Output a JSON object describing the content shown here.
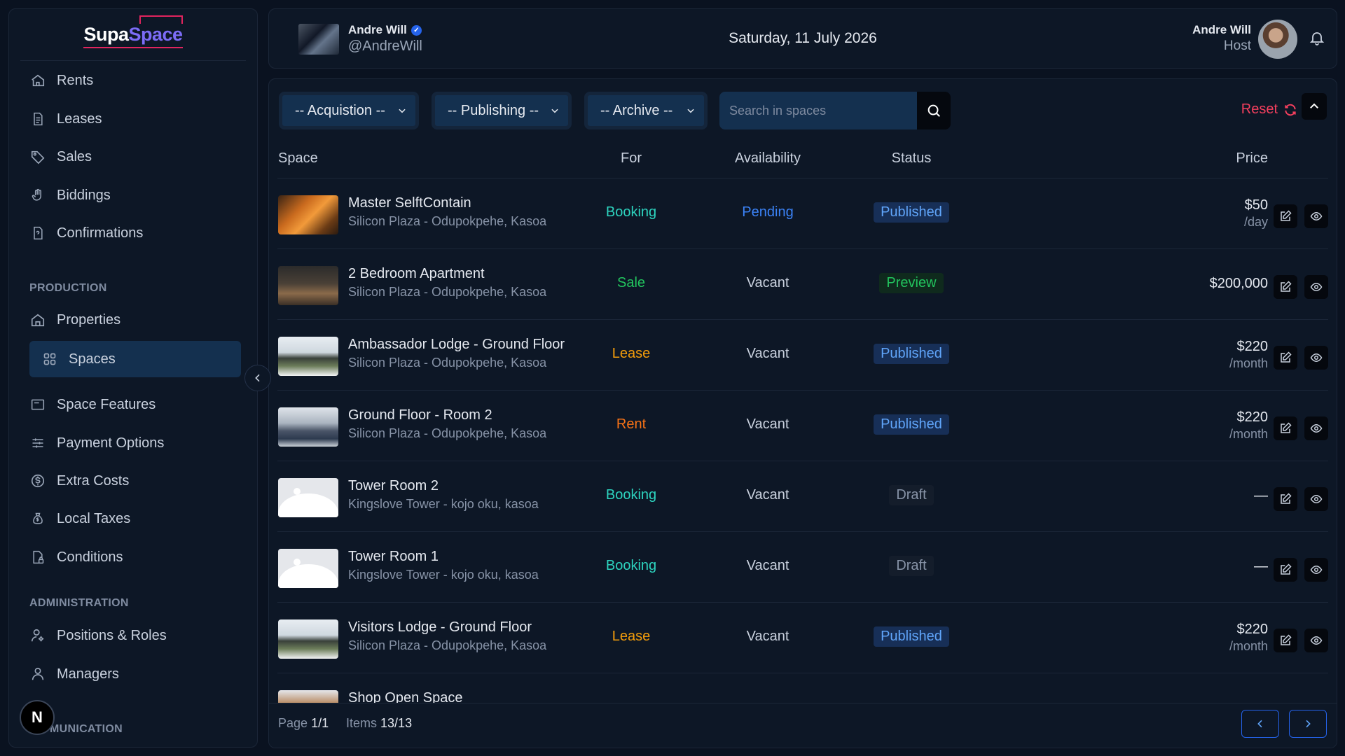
{
  "brand": {
    "part1": "Supa",
    "part2": "Space"
  },
  "sidebar": {
    "main_items": [
      {
        "label": "Rents",
        "icon": "home-icon"
      },
      {
        "label": "Leases",
        "icon": "document-icon"
      },
      {
        "label": "Sales",
        "icon": "tag-icon"
      },
      {
        "label": "Biddings",
        "icon": "hand-icon"
      },
      {
        "label": "Confirmations",
        "icon": "file-check-icon"
      }
    ],
    "production_label": "PRODUCTION",
    "production_items": [
      {
        "label": "Properties",
        "icon": "building-icon"
      },
      {
        "label": "Spaces",
        "icon": "grid-icon",
        "active": true
      },
      {
        "label": "Space Features",
        "icon": "panel-icon"
      },
      {
        "label": "Payment Options",
        "icon": "sliders-icon"
      },
      {
        "label": "Extra Costs",
        "icon": "dollar-icon"
      },
      {
        "label": "Local Taxes",
        "icon": "tax-icon"
      },
      {
        "label": "Conditions",
        "icon": "file-lock-icon"
      }
    ],
    "administration_label": "ADMINISTRATION",
    "administration_items": [
      {
        "label": "Positions & Roles",
        "icon": "user-key-icon"
      },
      {
        "label": "Managers",
        "icon": "user-icon"
      }
    ],
    "communication_label": "MUNICATION",
    "badge_letter": "N"
  },
  "header": {
    "name": "Andre Will",
    "handle": "@AndreWill",
    "date": "Saturday, 11 July 2026",
    "user_name": "Andre Will",
    "user_role": "Host"
  },
  "filters": {
    "acquisition": "-- Acquistion --",
    "publishing": "-- Publishing --",
    "archive": "-- Archive --",
    "search_placeholder": "Search in spaces",
    "reset": "Reset"
  },
  "table": {
    "headers": {
      "space": "Space",
      "for": "For",
      "availability": "Availability",
      "status": "Status",
      "price": "Price"
    },
    "rows": [
      {
        "title": "Master SelftContain",
        "sub": "Silicon Plaza - Odupokpehe, Kasoa",
        "for": "Booking",
        "availability": "Pending",
        "status": "Published",
        "price": "$50",
        "per": "/day"
      },
      {
        "title": "2 Bedroom Apartment",
        "sub": "Silicon Plaza - Odupokpehe, Kasoa",
        "for": "Sale",
        "availability": "Vacant",
        "status": "Preview",
        "price": "$200,000",
        "per": ""
      },
      {
        "title": "Ambassador Lodge - Ground Floor",
        "sub": "Silicon Plaza - Odupokpehe, Kasoa",
        "for": "Lease",
        "availability": "Vacant",
        "status": "Published",
        "price": "$220",
        "per": "/month"
      },
      {
        "title": "Ground Floor - Room 2",
        "sub": "Silicon Plaza - Odupokpehe, Kasoa",
        "for": "Rent",
        "availability": "Vacant",
        "status": "Published",
        "price": "$220",
        "per": "/month"
      },
      {
        "title": "Tower Room 2",
        "sub": "Kingslove Tower - kojo oku, kasoa",
        "for": "Booking",
        "availability": "Vacant",
        "status": "Draft",
        "price": "—",
        "per": ""
      },
      {
        "title": "Tower Room 1",
        "sub": "Kingslove Tower - kojo oku, kasoa",
        "for": "Booking",
        "availability": "Vacant",
        "status": "Draft",
        "price": "—",
        "per": ""
      },
      {
        "title": "Visitors Lodge - Ground Floor",
        "sub": "Silicon Plaza - Odupokpehe, Kasoa",
        "for": "Lease",
        "availability": "Vacant",
        "status": "Published",
        "price": "$220",
        "per": "/month"
      },
      {
        "title": "Shop Open Space",
        "sub": "",
        "for": "",
        "availability": "",
        "status": "",
        "price": "",
        "per": ""
      }
    ]
  },
  "pagination": {
    "page_label": "Page",
    "page_value": "1/1",
    "items_label": "Items",
    "items_value": "13/13"
  },
  "colors": {
    "accent": "#2563eb",
    "booking": "#2dd4bf",
    "sale": "#22c55e",
    "lease": "#f59e0b",
    "rent": "#f97316",
    "reset": "#f43f5e"
  }
}
